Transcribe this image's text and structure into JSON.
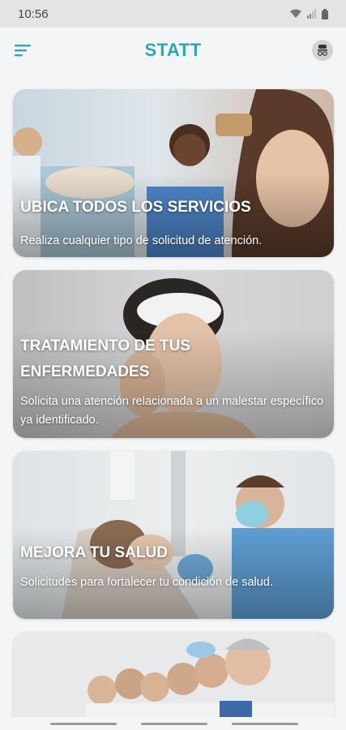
{
  "status_bar": {
    "time": "10:56"
  },
  "header": {
    "title": "STATT"
  },
  "cards": [
    {
      "title": "UBICA TODOS LOS SERVICIOS",
      "description": "Realiza cualquier tipo de solicitud de atención."
    },
    {
      "title": "TRATAMIENTO DE TUS\nENFERMEDADES",
      "description": "Solicita una atención relacionada a un malestar específico ya identificado."
    },
    {
      "title": "MEJORA TU SALUD",
      "description": "Solicitudes para fortalecer tu condición de salud."
    },
    {
      "title": "",
      "description": ""
    }
  ],
  "colors": {
    "brand": "#2aa8b8",
    "card_text": "#ffffff",
    "status_bar": "#e4e4e4"
  }
}
